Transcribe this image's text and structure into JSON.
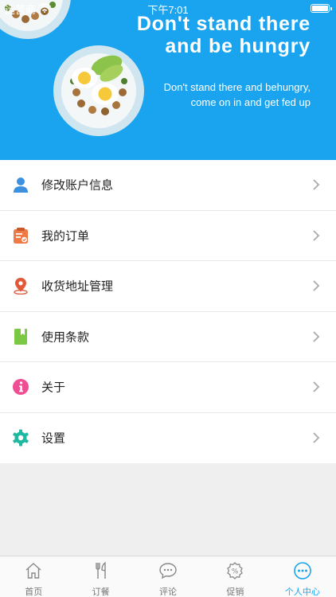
{
  "status_bar": {
    "carrier": "运营商",
    "time": "下午7:01"
  },
  "banner": {
    "headline_line1": "Don't stand there",
    "headline_line2": "and be hungry",
    "subline_line1": "Don't stand there and behungry,",
    "subline_line2": "come on in and get fed up"
  },
  "menu": {
    "items": [
      {
        "label": "修改账户信息",
        "icon": "user-icon",
        "color": "#3d8fe0"
      },
      {
        "label": "我的订单",
        "icon": "order-clipboard-icon",
        "color": "#f07a45"
      },
      {
        "label": "收货地址管理",
        "icon": "location-pin-icon",
        "color": "#e05a3a"
      },
      {
        "label": "使用条款",
        "icon": "book-icon",
        "color": "#7bc843"
      },
      {
        "label": "关于",
        "icon": "info-icon",
        "color": "#ef4f92"
      },
      {
        "label": "设置",
        "icon": "gear-icon",
        "color": "#1fb8a0"
      }
    ]
  },
  "tabbar": {
    "accent_color": "#1aa4f0",
    "tabs": [
      {
        "label": "首页",
        "icon": "home-icon"
      },
      {
        "label": "订餐",
        "icon": "fork-knife-icon"
      },
      {
        "label": "评论",
        "icon": "comment-icon"
      },
      {
        "label": "促销",
        "icon": "discount-icon"
      },
      {
        "label": "个人中心",
        "icon": "profile-more-icon",
        "active": true
      }
    ]
  }
}
